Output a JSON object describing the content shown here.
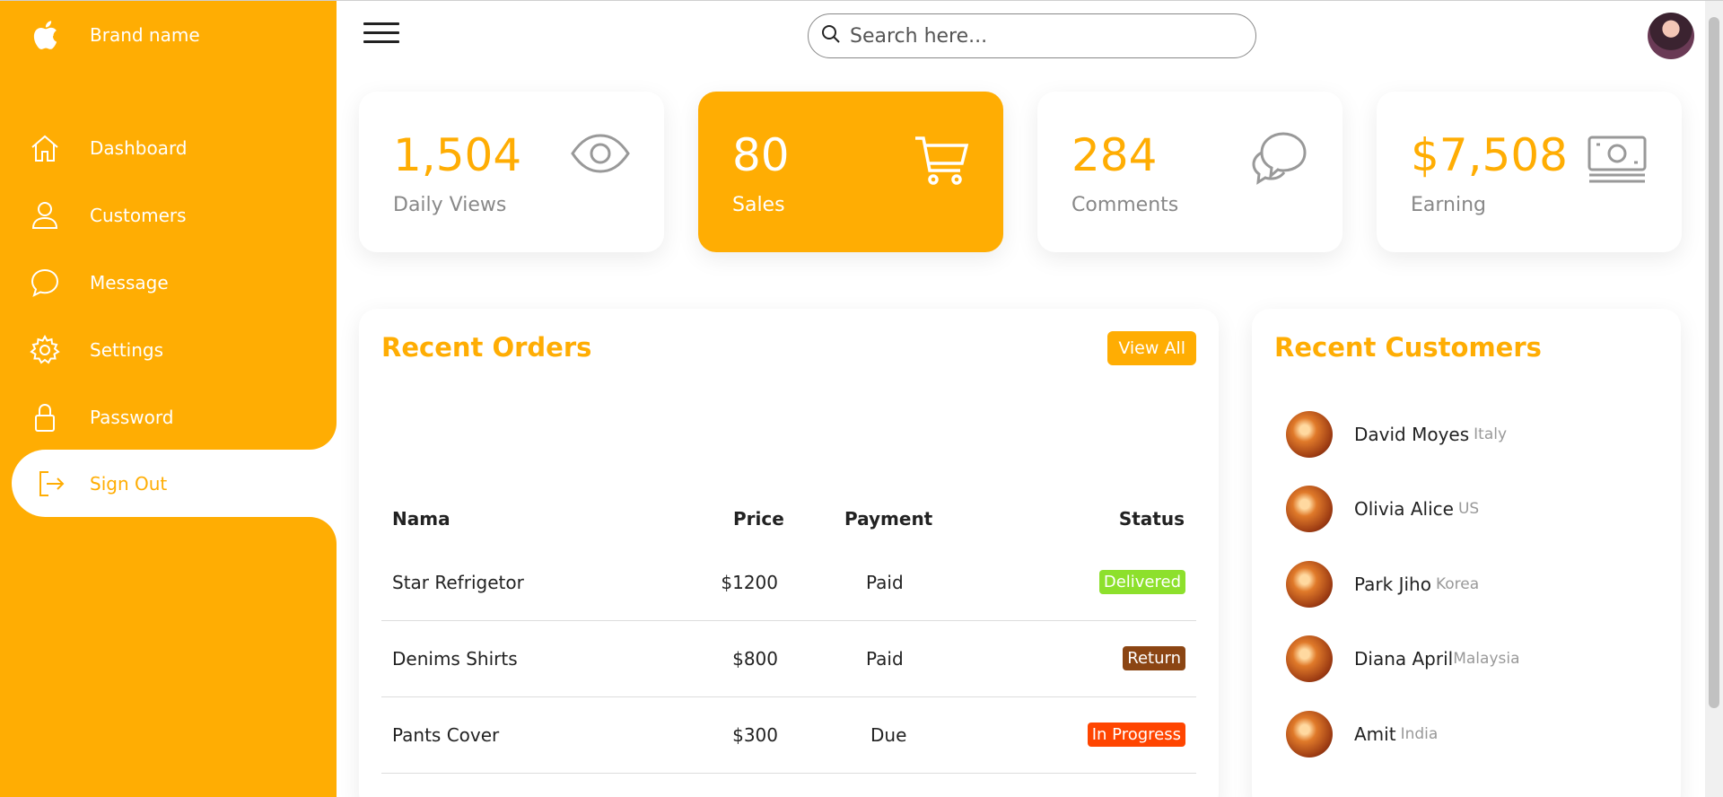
{
  "sidebar": {
    "brand": "Brand name",
    "items": [
      {
        "label": "Dashboard",
        "icon": "home-icon"
      },
      {
        "label": "Customers",
        "icon": "person-icon"
      },
      {
        "label": "Message",
        "icon": "chat-icon"
      },
      {
        "label": "Settings",
        "icon": "gear-icon"
      },
      {
        "label": "Password",
        "icon": "lock-icon"
      },
      {
        "label": "Sign Out",
        "icon": "logout-icon",
        "active": true
      }
    ]
  },
  "topbar": {
    "search_placeholder": "Search here..."
  },
  "cards": [
    {
      "value": "1,504",
      "label": "Daily Views",
      "icon": "eye-icon"
    },
    {
      "value": "80",
      "label": "Sales",
      "icon": "cart-icon",
      "highlight": true
    },
    {
      "value": "284",
      "label": "Comments",
      "icon": "comments-icon"
    },
    {
      "value": "$7,508",
      "label": "Earning",
      "icon": "cash-icon"
    }
  ],
  "orders": {
    "title": "Recent Orders",
    "view_all": "View All",
    "columns": [
      "Nama",
      "Price",
      "Payment",
      "Status"
    ],
    "rows": [
      {
        "name": "Star Refrigetor",
        "price": "$1200",
        "payment": "Paid",
        "status": "Delivered"
      },
      {
        "name": "Denims Shirts",
        "price": "$800",
        "payment": "Paid",
        "status": "Return"
      },
      {
        "name": "Pants Cover",
        "price": "$300",
        "payment": "Due",
        "status": "In Progress"
      }
    ]
  },
  "customers": {
    "title": "Recent Customers",
    "list": [
      {
        "name": "David Moyes",
        "country": "Italy"
      },
      {
        "name": "Olivia Alice",
        "country": "US"
      },
      {
        "name": "Park Jiho",
        "country": "Korea"
      },
      {
        "name": "Diana April",
        "country": "Malaysia"
      },
      {
        "name": "Amit",
        "country": "India"
      }
    ]
  },
  "colors": {
    "accent": "#ffad03",
    "delivered": "#8de02c",
    "return": "#8b4513",
    "in_progress": "#ff4500"
  }
}
